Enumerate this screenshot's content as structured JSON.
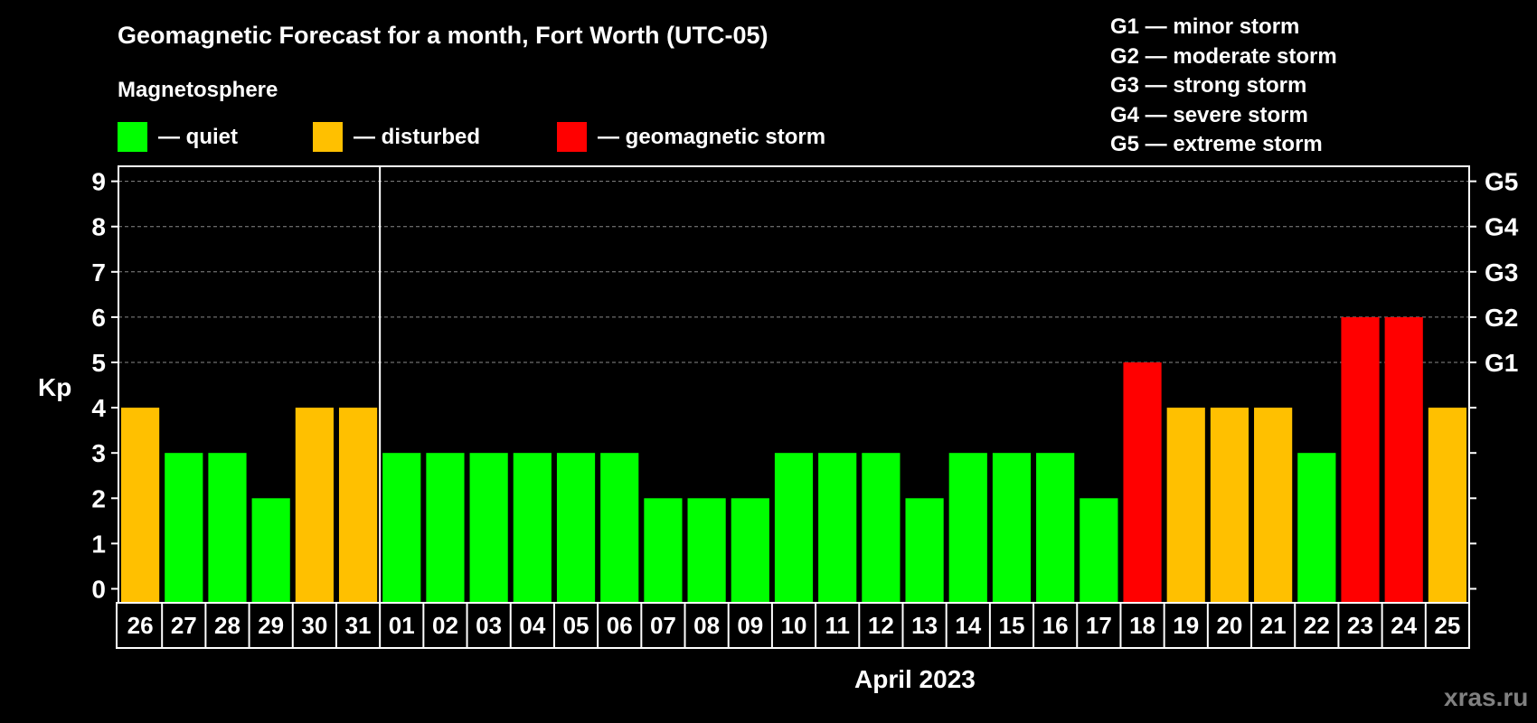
{
  "chart_data": {
    "type": "bar",
    "title": "Geomagnetic Forecast for a month, Fort Worth (UTC-05)",
    "subtitle": "Magnetosphere",
    "ylabel": "Kp",
    "xlabel": "April 2023",
    "ylim": [
      0,
      9
    ],
    "yticks": [
      "0",
      "1",
      "2",
      "3",
      "4",
      "5",
      "6",
      "7",
      "8",
      "9"
    ],
    "right_ticks": [
      {
        "kp": 5,
        "label": "G1"
      },
      {
        "kp": 6,
        "label": "G2"
      },
      {
        "kp": 7,
        "label": "G3"
      },
      {
        "kp": 8,
        "label": "G4"
      },
      {
        "kp": 9,
        "label": "G5"
      }
    ],
    "categories": [
      "26",
      "27",
      "28",
      "29",
      "30",
      "31",
      "01",
      "02",
      "03",
      "04",
      "05",
      "06",
      "07",
      "08",
      "09",
      "10",
      "11",
      "12",
      "13",
      "14",
      "15",
      "16",
      "17",
      "18",
      "19",
      "20",
      "21",
      "22",
      "23",
      "24",
      "25"
    ],
    "values": [
      4,
      3,
      3,
      2,
      4,
      4,
      3,
      3,
      3,
      3,
      3,
      3,
      2,
      2,
      2,
      3,
      3,
      3,
      2,
      3,
      3,
      3,
      2,
      5,
      4,
      4,
      4,
      3,
      6,
      6,
      4
    ],
    "month_divider_after": "31",
    "legend": [
      {
        "label": "— quiet",
        "color": "#00ff00"
      },
      {
        "label": "— disturbed",
        "color": "#ffc000"
      },
      {
        "label": "— geomagnetic storm",
        "color": "#ff0000"
      }
    ],
    "storm_levels": [
      "G1 — minor storm",
      "G2 — moderate storm",
      "G3 — strong storm",
      "G4 — severe storm",
      "G5 — extreme storm"
    ],
    "grid": "dashed at 5-9"
  },
  "watermark": "xras.ru"
}
